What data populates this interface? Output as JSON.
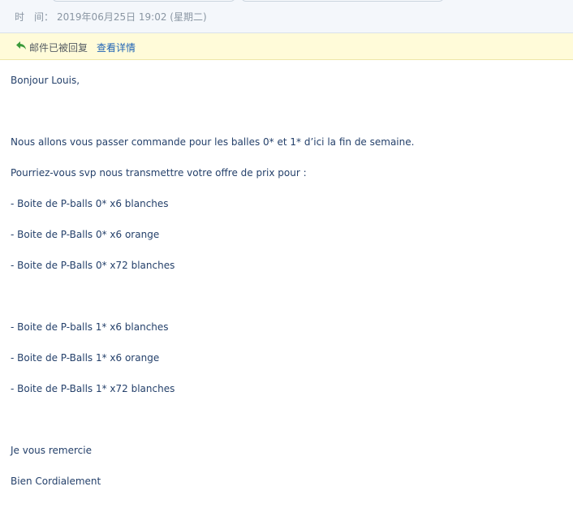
{
  "header": {
    "time_label": "时　间：",
    "time_value": "2019年06月25日 19:02 (星期二)"
  },
  "notice": {
    "replied_text": "邮件已被回复",
    "details_link": "查看详情"
  },
  "message": {
    "lines": [
      "Bonjour Louis,",
      "",
      "Nous allons vous passer commande pour les balles 0* et 1* d’ici la fin de semaine.",
      "Pourriez-vous svp nous transmettre votre offre de prix pour :",
      "- Boite de P-balls 0* x6 blanches",
      "- Boite de P-Balls 0* x6 orange",
      "- Boite de P-Balls 0* x72 blanches",
      "",
      "- Boite de P-balls 1* x6 blanches",
      "- Boite de P-Balls 1* x6 orange",
      "- Boite de P-Balls 1* x72 blanches",
      "",
      "Je vous remercie",
      "Bien Cordialement"
    ]
  },
  "colors": {
    "notice_bg": "#fffbd9",
    "link": "#1f63b5",
    "body_text": "#25416b",
    "reply_icon": "#3a9a3a"
  },
  "icons": {
    "reply": "reply-arrow-icon"
  }
}
